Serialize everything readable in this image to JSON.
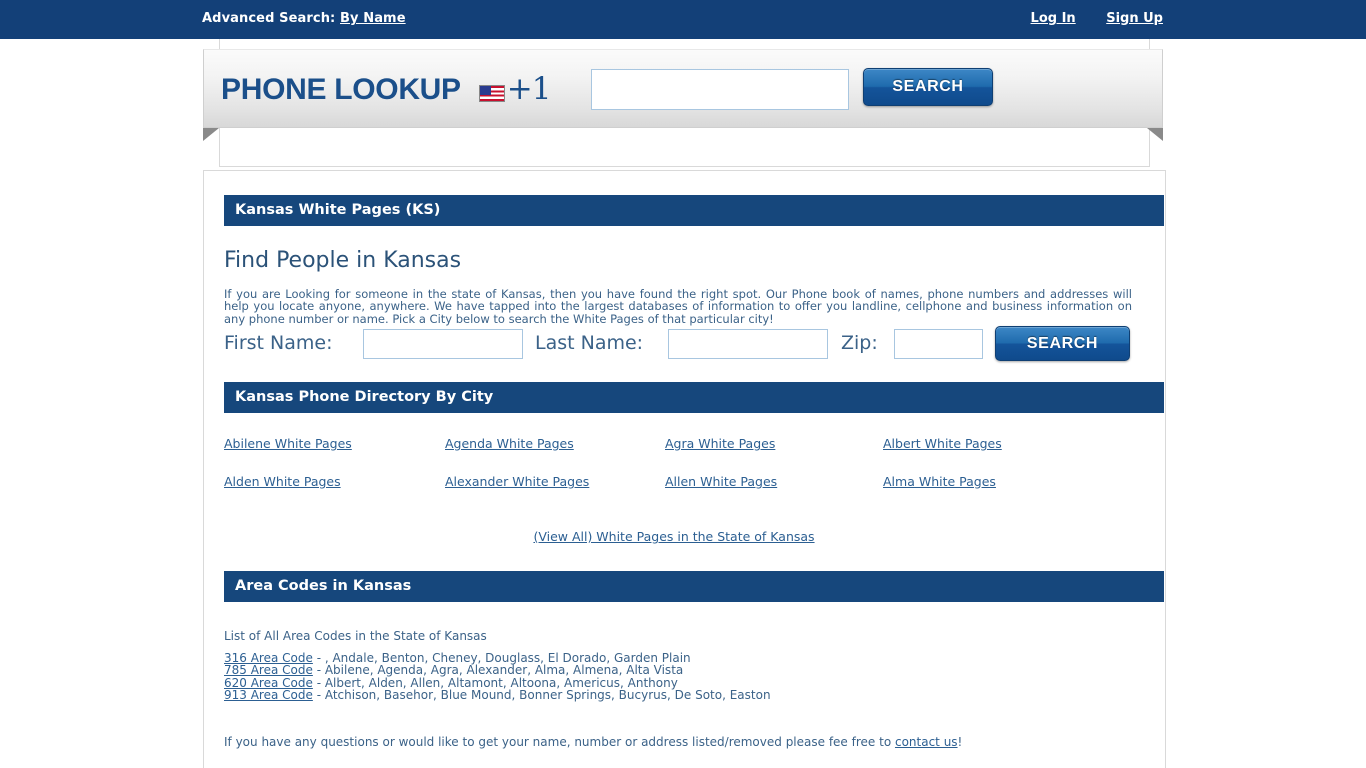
{
  "topbar": {
    "advanced_search_label": "Advanced Search:",
    "by_name_link": "By Name",
    "log_in": "Log In",
    "sign_up": "Sign Up"
  },
  "header": {
    "brand": "PHONE LOOKUP",
    "flag_icon": "us-flag-icon",
    "country_code": "+1",
    "phone_input_value": "",
    "phone_input_placeholder": "",
    "search_button": "SEARCH"
  },
  "sections": {
    "state_header": "Kansas White Pages (KS)",
    "directory_header": "Kansas Phone Directory By City",
    "area_codes_header": "Area Codes in Kansas"
  },
  "main": {
    "page_title": "Find People in Kansas",
    "intro": "If you are Looking for someone in the state of Kansas, then you have found the right spot. Our Phone book of names, phone numbers and addresses will help you locate anyone, anywhere. We have tapped into the largest databases of information to offer you landline, cellphone and business information on any phone number or name. Pick a City below to search the White Pages of that particular city!"
  },
  "search_form": {
    "first_name_label": "First Name:",
    "first_name_value": "",
    "last_name_label": "Last Name:",
    "last_name_value": "",
    "zip_label": "Zip:",
    "zip_value": "",
    "search_button": "SEARCH"
  },
  "city_links": [
    [
      "Abilene White Pages",
      "Agenda White Pages",
      "Agra White Pages",
      "Albert White Pages"
    ],
    [
      "Alden White Pages",
      "Alexander White Pages",
      "Allen White Pages",
      "Alma White Pages"
    ]
  ],
  "view_all_link": "(View All) White Pages in the State of Kansas",
  "area_codes": {
    "caption": "List of All Area Codes in the State of Kansas",
    "rows": [
      {
        "code": "316 Area Code",
        "cities": " - , Andale, Benton, Cheney, Douglass, El Dorado, Garden Plain"
      },
      {
        "code": "785 Area Code",
        "cities": " - Abilene, Agenda, Agra, Alexander, Alma, Almena, Alta Vista"
      },
      {
        "code": "620 Area Code",
        "cities": " - Albert, Alden, Allen, Altamont, Altoona, Americus, Anthony"
      },
      {
        "code": "913 Area Code",
        "cities": " - Atchison, Basehor, Blue Mound, Bonner Springs, Bucyrus, De Soto, Easton"
      }
    ]
  },
  "footnote": {
    "text_before": "If you have any questions or would like to get your name, number or address listed/removed please fee free to ",
    "contact_link": "contact us",
    "text_after": "!"
  },
  "colors": {
    "navy_bar": "#134078",
    "section_header": "#16477C",
    "link": "#2C5F92",
    "body_text": "#3B6288",
    "brand": "#1B4F8A"
  }
}
